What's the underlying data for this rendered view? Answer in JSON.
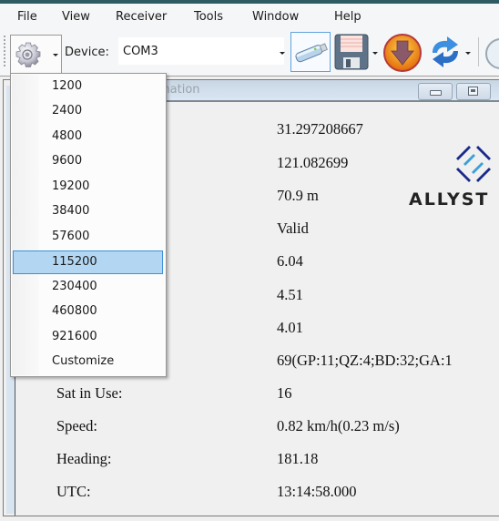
{
  "menubar": {
    "items": [
      "File",
      "View",
      "Receiver",
      "Tools",
      "Window",
      "Help"
    ]
  },
  "toolbar": {
    "settings_icon": "gear-icon",
    "device_label": "Device:",
    "device_value": "COM3",
    "buttons": [
      {
        "name": "usb-connect",
        "icon": "usb-drive-icon",
        "active": true
      },
      {
        "name": "save",
        "icon": "floppy-disk-icon",
        "has_dropdown": true
      },
      {
        "name": "download",
        "icon": "download-arrow-icon"
      },
      {
        "name": "refresh",
        "icon": "refresh-arrows-icon",
        "has_dropdown": true
      },
      {
        "name": "timer",
        "icon": "stopwatch-icon"
      }
    ]
  },
  "baudrate_dropdown": {
    "options": [
      "1200",
      "2400",
      "4800",
      "9600",
      "19200",
      "38400",
      "57600",
      "115200",
      "230400",
      "460800",
      "921600",
      "Customize"
    ],
    "selected": "115200"
  },
  "subwindow": {
    "title_visible": "mation",
    "rows": [
      {
        "label": "",
        "value": "31.297208667"
      },
      {
        "label": "",
        "value": "121.082699"
      },
      {
        "label": "",
        "value": "70.9 m"
      },
      {
        "label": "",
        "value": "Valid"
      },
      {
        "label": "",
        "value": "6.04"
      },
      {
        "label": "",
        "value": "4.51"
      },
      {
        "label": "",
        "value": "4.01"
      },
      {
        "label": "",
        "value": "69(GP:11;QZ:4;BD:32;GA:1"
      },
      {
        "label": "Sat in Use:",
        "value": "16"
      },
      {
        "label": "Speed:",
        "value": "0.82 km/h(0.23 m/s)"
      },
      {
        "label": "Heading:",
        "value": "181.18"
      },
      {
        "label": "UTC:",
        "value": "13:14:58.000"
      }
    ],
    "logo_text": "ALLYST"
  },
  "colors": {
    "selection_bg": "#b3d7f3",
    "selection_border": "#3c8fd9",
    "logo_dark": "#1b2a8a",
    "logo_light": "#3aa0d8"
  }
}
